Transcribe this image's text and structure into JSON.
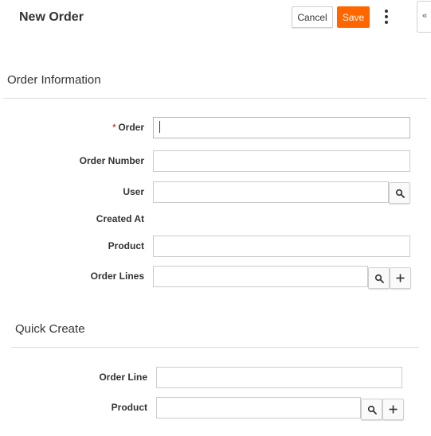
{
  "header": {
    "title": "New Order",
    "cancel_label": "Cancel",
    "save_label": "Save",
    "collapse_label": "«"
  },
  "order_information": {
    "section_title": "Order Information",
    "required_marker": "*",
    "fields": {
      "order": {
        "label": "Order",
        "value": ""
      },
      "order_number": {
        "label": "Order Number",
        "value": ""
      },
      "user": {
        "label": "User",
        "value": ""
      },
      "created_at": {
        "label": "Created At"
      },
      "product": {
        "label": "Product",
        "value": ""
      },
      "order_lines": {
        "label": "Order Lines",
        "value": ""
      }
    }
  },
  "quick_create": {
    "section_title": "Quick Create",
    "fields": {
      "order_line": {
        "label": "Order Line",
        "value": ""
      },
      "product": {
        "label": "Product",
        "value": ""
      }
    }
  },
  "icons": {
    "search": "search-icon",
    "plus": "plus-icon",
    "more": "kebab-menu-icon"
  },
  "colors": {
    "save": "#ff6600",
    "required": "#e0201c",
    "border": "#cccccc"
  }
}
